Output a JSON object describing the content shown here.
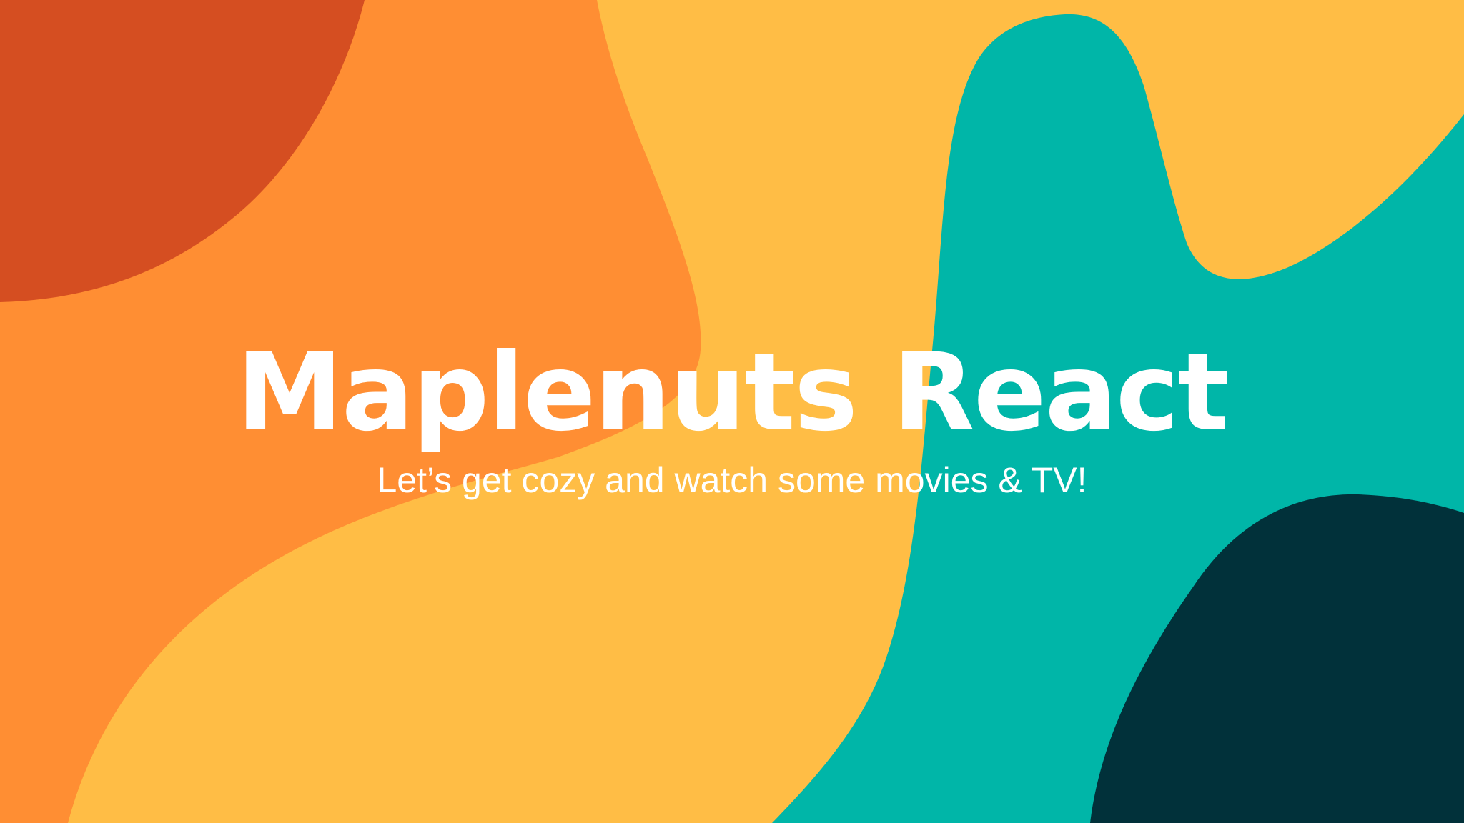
{
  "hero": {
    "title": "Maplenuts React",
    "subtitle": "Let’s get cozy and watch some movies & TV!"
  },
  "palette": {
    "yellow": "#ffbd45",
    "orange": "#ff8e33",
    "burnt_orange": "#d54e21",
    "teal": "#00b6a8",
    "dark_teal": "#01313a",
    "text": "#ffffff"
  }
}
